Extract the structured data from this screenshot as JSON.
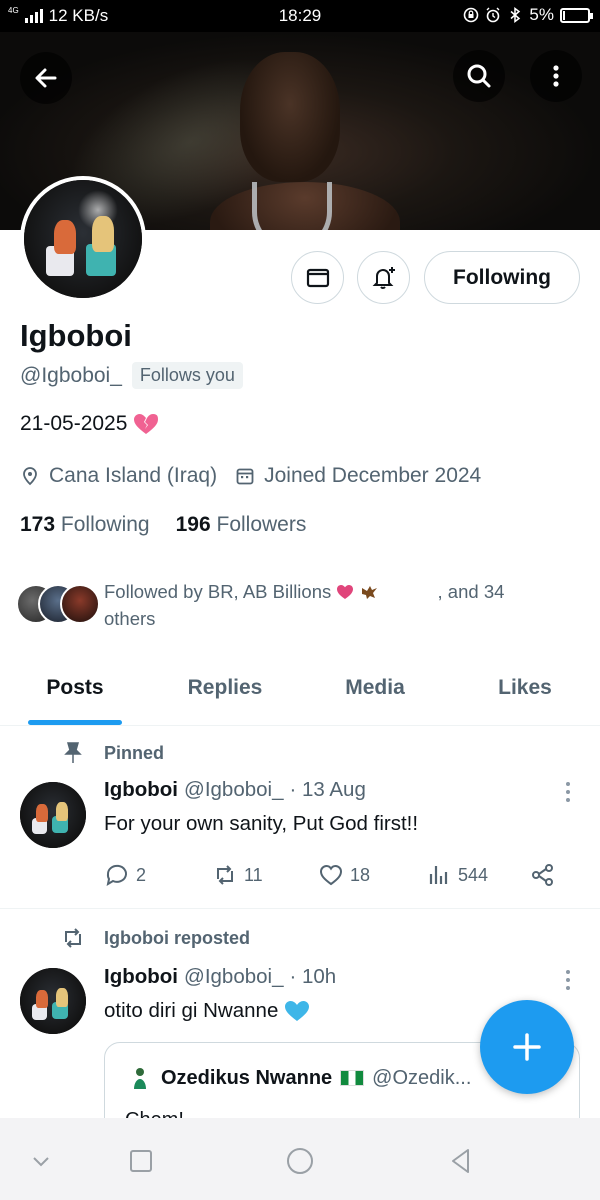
{
  "status_bar": {
    "network_type": "4G",
    "speed": "12 KB/s",
    "time": "18:29",
    "battery": "5%",
    "battery_level": 0.05
  },
  "header": {
    "back_icon": "arrow-left-icon",
    "search_icon": "search-icon",
    "more_icon": "more-vertical-icon"
  },
  "profile": {
    "name": "Igboboi",
    "handle": "@Igboboi_",
    "follows_you": "Follows you",
    "bio": "21-05-2025",
    "bio_emoji": "broken-heart",
    "location": "Cana Island (Iraq)",
    "joined": "Joined December 2024",
    "following_count": "173",
    "following_label": "Following",
    "followers_count": "196",
    "followers_label": "Followers",
    "follow_button": "Following",
    "followed_by_prefix": "Followed by BR, AB Billions",
    "followed_by_suffix": ", and 34 others"
  },
  "tabs": [
    {
      "label": "Posts",
      "active": true
    },
    {
      "label": "Replies",
      "active": false
    },
    {
      "label": "Media",
      "active": false
    },
    {
      "label": "Likes",
      "active": false
    }
  ],
  "posts": [
    {
      "context": "Pinned",
      "author": "Igboboi",
      "handle": "@Igboboi_",
      "time": "· 13 Aug",
      "text": "For your own sanity, Put God first!!",
      "replies": "2",
      "reposts": "11",
      "likes": "18",
      "views": "544"
    },
    {
      "context": "Igboboi reposted",
      "author": "Igboboi",
      "handle": "@Igboboi_",
      "time": "· 10h",
      "text": "otito diri gi Nwanne",
      "quote": {
        "author": "Ozedikus Nwanne",
        "handle": "@Ozedik...",
        "text": "Chem!"
      }
    }
  ],
  "colors": {
    "accent": "#1d9bf0",
    "text": "#0f1419",
    "secondary_text": "#536471",
    "border": "#cfd9de"
  }
}
